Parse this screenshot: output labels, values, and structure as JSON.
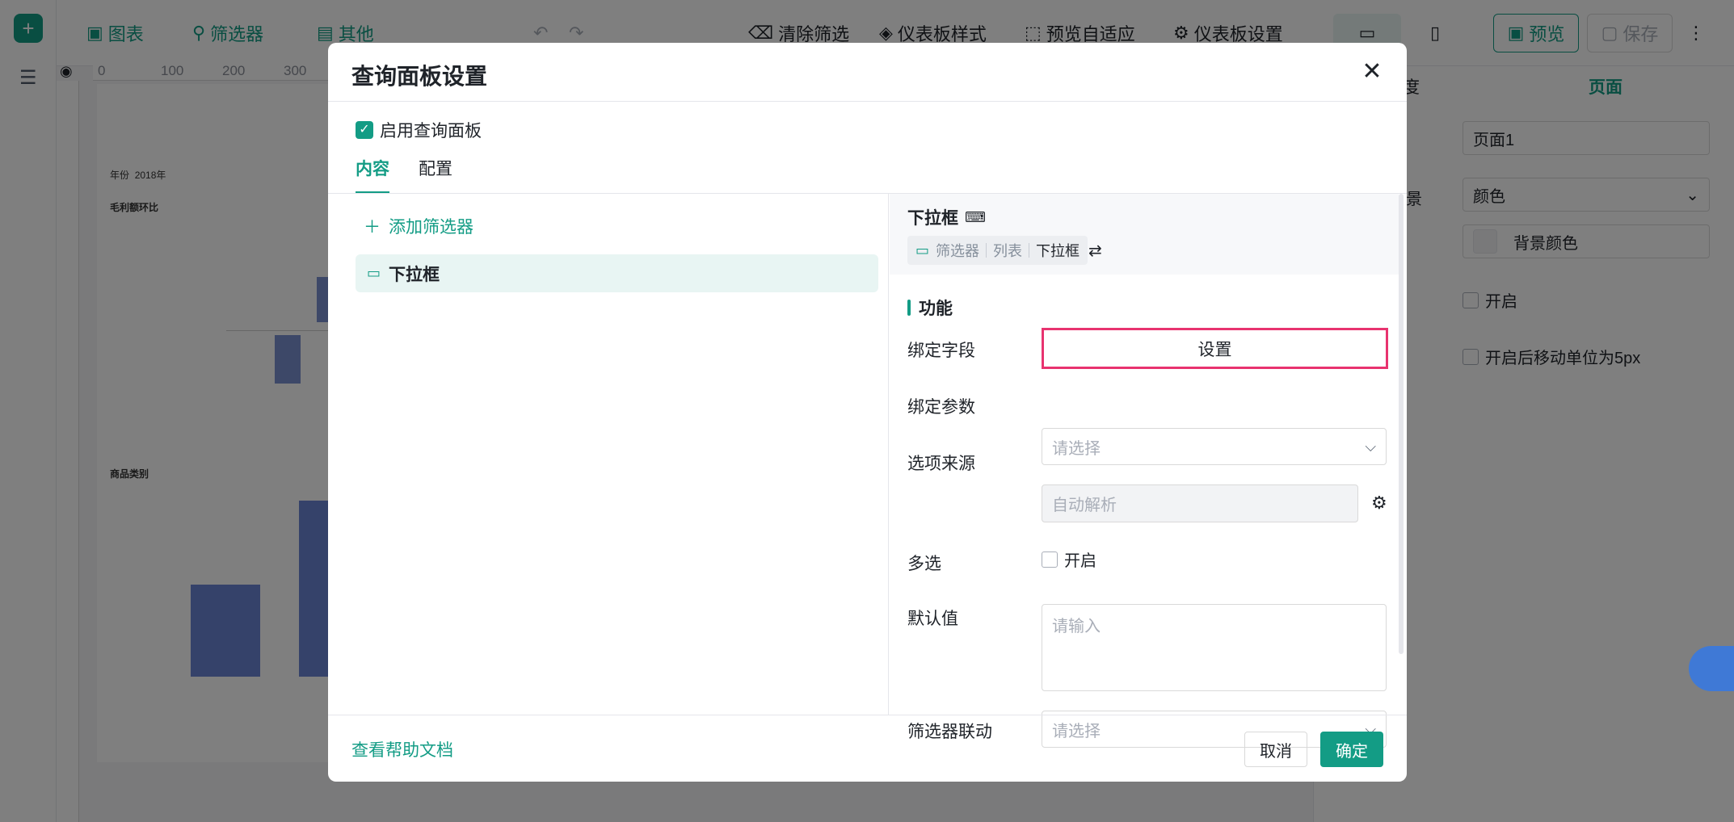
{
  "toolbar": {
    "chart": "图表",
    "filter": "筛选器",
    "other": "其他",
    "clear_filter": "清除筛选",
    "dashboard_style": "仪表板样式",
    "preview_adapt": "预览自适应",
    "dashboard_settings": "仪表板设置",
    "preview": "预览",
    "save": "保存"
  },
  "canvas": {
    "ruler_ticks": [
      "0",
      "100",
      "200",
      "300"
    ],
    "year_label": "年份",
    "year_value": "2018年",
    "chart1_title": "毛利额环比",
    "chart2_title": "商品类别"
  },
  "right_panel": {
    "tab_partial": "度",
    "tab_page": "页面",
    "page_name": "页面1",
    "bg_label_partial": "景",
    "bg_type": "颜色",
    "bg_color_label": "背景颜色",
    "open_label": "开启",
    "move_unit_label": "开启后移动单位为5px"
  },
  "modal": {
    "title": "查询面板设置",
    "enable_label": "启用查询面板",
    "tabs": [
      "内容",
      "配置"
    ],
    "add_filter": "添加筛选器",
    "filter_item": "下拉框",
    "right": {
      "title": "下拉框",
      "crumbs": [
        "筛选器",
        "列表",
        "下拉框"
      ],
      "section": "功能",
      "bind_field_label": "绑定字段",
      "bind_field_button": "设置",
      "bind_param_label": "绑定参数",
      "bind_param_placeholder": "请选择",
      "option_source_label": "选项来源",
      "option_source_value": "自动解析",
      "multi_label": "多选",
      "multi_open": "开启",
      "default_label": "默认值",
      "default_placeholder": "请输入",
      "linkage_label": "筛选器联动",
      "linkage_placeholder": "请选择"
    },
    "help_link": "查看帮助文档",
    "cancel": "取消",
    "confirm": "确定"
  },
  "colors": {
    "accent": "#139c85",
    "highlight_border": "#e8336f"
  }
}
